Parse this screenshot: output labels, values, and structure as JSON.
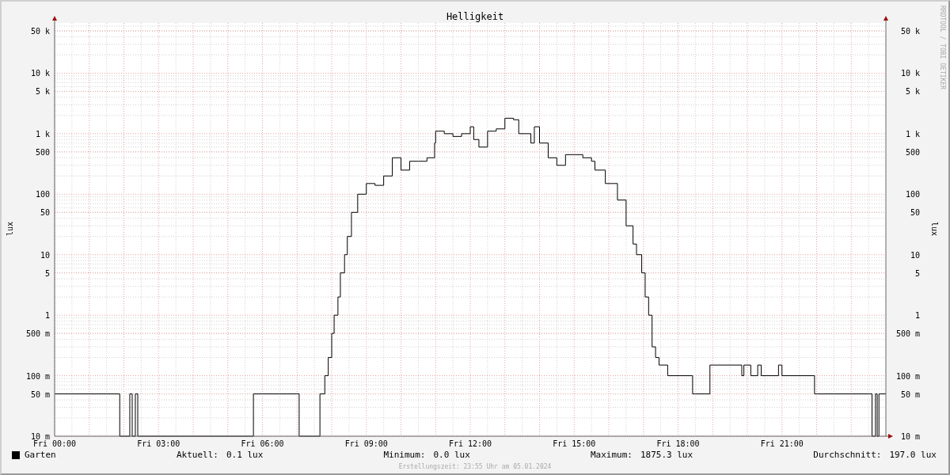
{
  "watermark": "RRDTOOL / TOBI OETIKER",
  "title": "Helligkeit",
  "y_axis_left": {
    "title": "lux",
    "ticks": [
      "50 k",
      "10 k",
      "5 k",
      "1 k",
      "500",
      "100",
      "50",
      "10",
      "5",
      "1",
      "500 m",
      "100 m",
      "50 m",
      "10 m"
    ]
  },
  "y_axis_right": {
    "title": "lux",
    "ticks": [
      "50 k",
      "10 k",
      "5 k",
      "1 k",
      "500",
      "100",
      "50",
      "10",
      "5",
      "1",
      "500 m",
      "100 m",
      "50 m",
      "10 m"
    ]
  },
  "x_axis": {
    "ticks": [
      "Fri 00:00",
      "Fri 03:00",
      "Fri 06:00",
      "Fri 09:00",
      "Fri 12:00",
      "Fri 15:00",
      "Fri 18:00",
      "Fri 21:00"
    ]
  },
  "legend": {
    "series_name": "Garten",
    "stats": [
      {
        "label": "Aktuell:",
        "value": "0.1 lux"
      },
      {
        "label": "Minimum:",
        "value": "0.0 lux"
      },
      {
        "label": "Maximum:",
        "value": "1875.3 lux"
      },
      {
        "label": "Durchschnitt:",
        "value": "197.0 lux"
      }
    ]
  },
  "footer": "Erstellungszeit: 23:55 Uhr am 05.01.2024"
}
